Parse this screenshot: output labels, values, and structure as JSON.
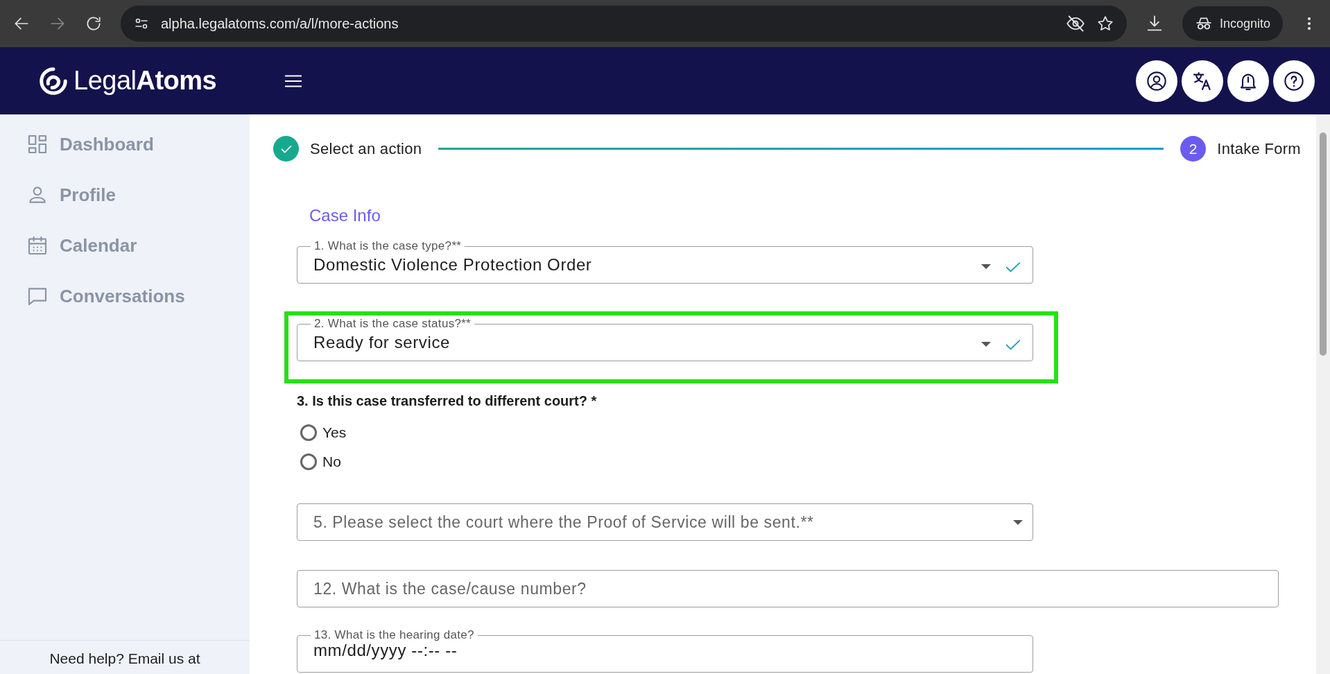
{
  "browser": {
    "url": "alpha.legalatoms.com/a/l/more-actions",
    "profile": "Incognito"
  },
  "header": {
    "logo": "Legal**Atoms**"
  },
  "sidebar": {
    "items": [
      {
        "label": "Dashboard"
      },
      {
        "label": "Profile"
      },
      {
        "label": "Calendar"
      },
      {
        "label": "Conversations"
      }
    ],
    "help_text": "Need help? Email us at"
  },
  "stepper": [
    {
      "label": "Select an action",
      "completed": true
    },
    {
      "label": "Intake Form",
      "number": "2",
      "completed": false
    }
  ],
  "section_title": "Case Info",
  "fields": [
    {
      "kind": "select",
      "label": "1. What is the case type?**",
      "value": "Domestic Violence Protection Order",
      "valid": true,
      "highlighted": false
    },
    {
      "kind": "select",
      "label": "2. What is the case status?**",
      "value": "Ready for service",
      "valid": true,
      "highlighted": true
    },
    {
      "kind": "radio",
      "question": "3. Is this case transferred to different court? *",
      "options": [
        {
          "label": "Yes",
          "selected": false
        },
        {
          "label": "No",
          "selected": false
        }
      ]
    },
    {
      "kind": "select",
      "placeholder": "5. Please select the court where the Proof of Service will be sent.**",
      "valid": false,
      "highlighted": false
    },
    {
      "kind": "text",
      "placeholder": "12. What is the case/cause number?"
    },
    {
      "kind": "datetime",
      "label": "13. What is the hearing date?",
      "value": "mm/dd/yyyy --:-- --"
    }
  ]
}
